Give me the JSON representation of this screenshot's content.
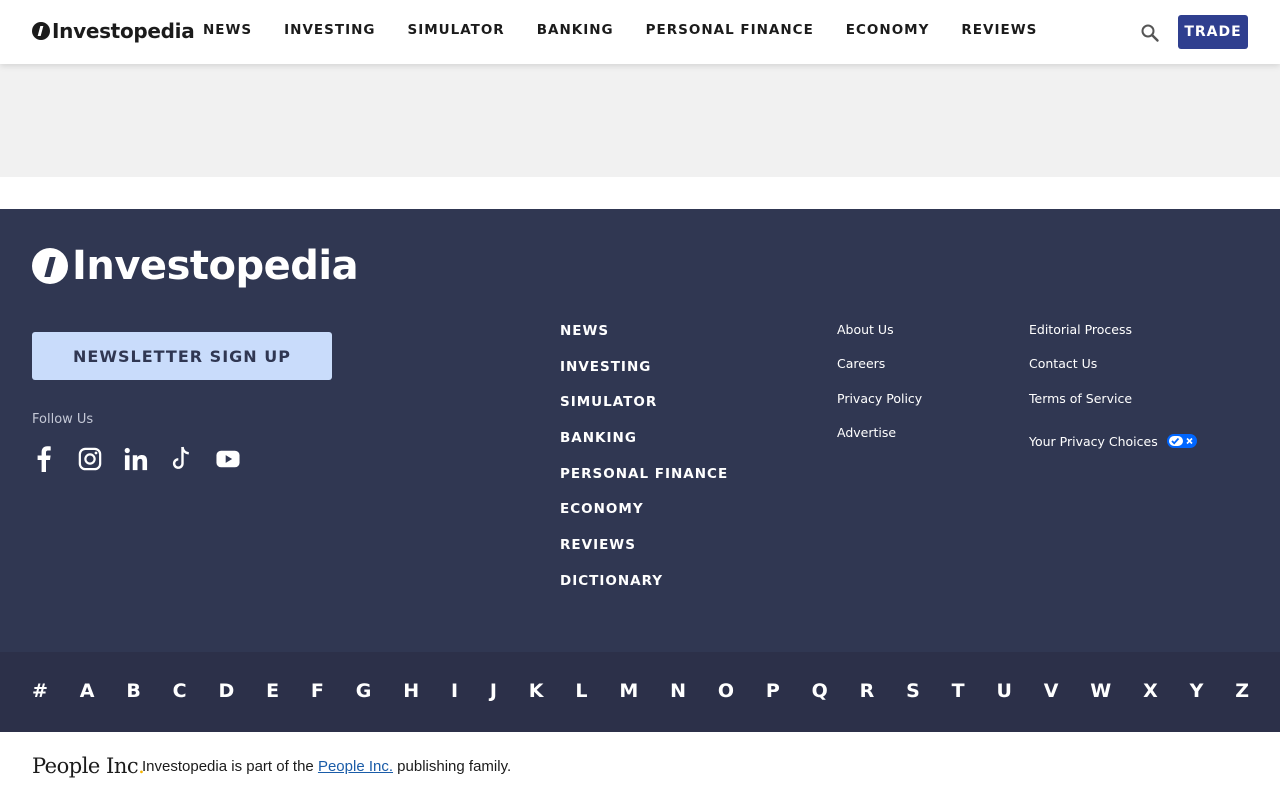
{
  "header": {
    "logo_text": "Investopedia",
    "nav": [
      "NEWS",
      "INVESTING",
      "SIMULATOR",
      "BANKING",
      "PERSONAL FINANCE",
      "ECONOMY",
      "REVIEWS"
    ],
    "trade_label": "TRADE",
    "search_icon": "search-icon"
  },
  "footer": {
    "logo_text": "Investopedia",
    "newsletter_label": "NEWSLETTER SIGN UP",
    "follow_label": "Follow Us",
    "socials": [
      "facebook-icon",
      "instagram-icon",
      "linkedin-icon",
      "tiktok-icon",
      "youtube-icon"
    ],
    "nav": [
      "NEWS",
      "INVESTING",
      "SIMULATOR",
      "BANKING",
      "PERSONAL FINANCE",
      "ECONOMY",
      "REVIEWS",
      "DICTIONARY"
    ],
    "links_col1": [
      "About Us",
      "Careers",
      "Privacy Policy",
      "Advertise"
    ],
    "links_col2": [
      "Editorial Process",
      "Contact Us",
      "Terms of Service",
      "Your Privacy Choices"
    ],
    "alphabet": [
      "#",
      "A",
      "B",
      "C",
      "D",
      "E",
      "F",
      "G",
      "H",
      "I",
      "J",
      "K",
      "L",
      "M",
      "N",
      "O",
      "P",
      "Q",
      "R",
      "S",
      "T",
      "U",
      "V",
      "W",
      "X",
      "Y",
      "Z"
    ]
  },
  "publisher": {
    "logo_text": "People Inc",
    "logo_dot": ".",
    "text_before": "Investopedia is part of the ",
    "link_text": "People Inc.",
    "text_after": " publishing family."
  },
  "colors": {
    "footer_bg": "#303752",
    "alpha_bg": "#2c3049",
    "trade_bg": "#2f3f8f",
    "newsletter_bg": "#c9dcfb",
    "privacy_toggle": "#0066ff"
  }
}
